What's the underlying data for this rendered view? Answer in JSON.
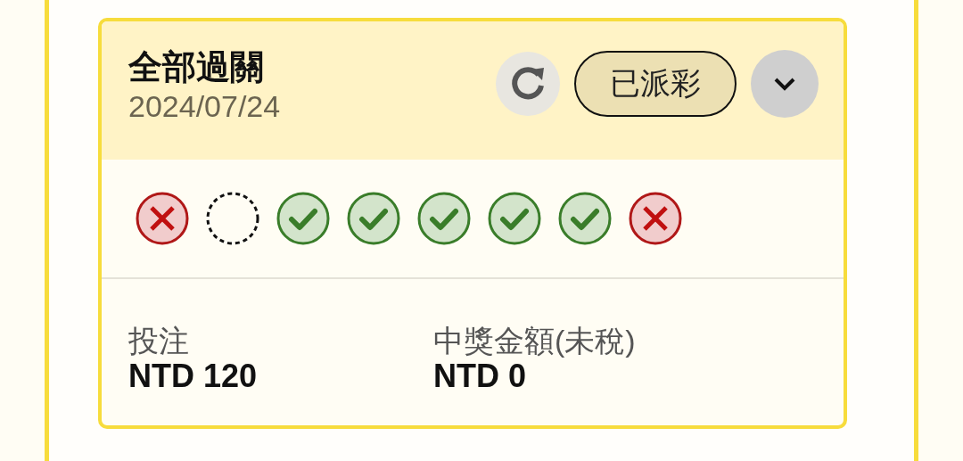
{
  "bet": {
    "title": "全部過關",
    "date": "2024/07/24",
    "status": "已派彩",
    "expanded": false,
    "results": [
      {
        "kind": "lose"
      },
      {
        "kind": "pending"
      },
      {
        "kind": "win"
      },
      {
        "kind": "win"
      },
      {
        "kind": "win"
      },
      {
        "kind": "win"
      },
      {
        "kind": "win"
      },
      {
        "kind": "lose"
      }
    ],
    "amounts": [
      {
        "label": "投注",
        "value": "NTD 120"
      },
      {
        "label": "中獎金額(未稅)",
        "value": "NTD 0"
      }
    ]
  }
}
